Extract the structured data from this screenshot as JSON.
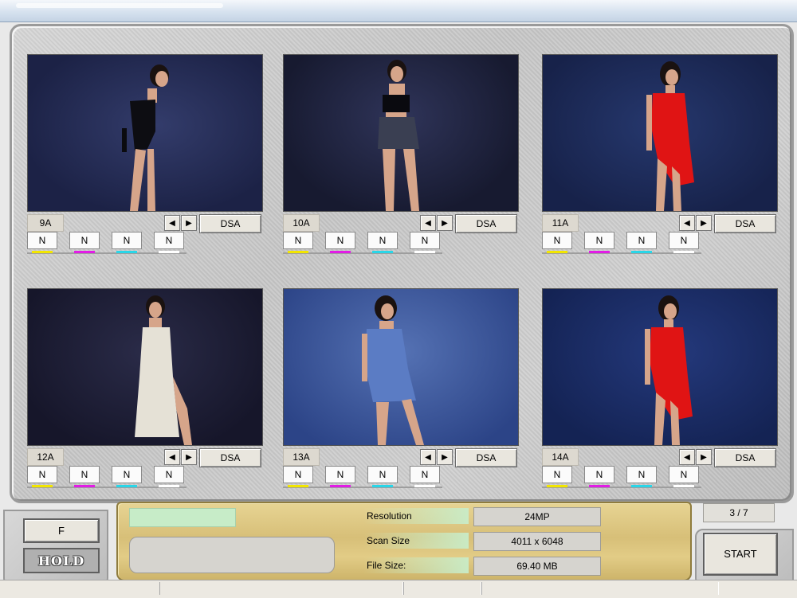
{
  "thumbnails": [
    {
      "label": "9A",
      "button": "DSA",
      "channels": [
        "N",
        "N",
        "N",
        "N"
      ]
    },
    {
      "label": "10A",
      "button": "DSA",
      "channels": [
        "N",
        "N",
        "N",
        "N"
      ]
    },
    {
      "label": "11A",
      "button": "DSA",
      "channels": [
        "N",
        "N",
        "N",
        "N"
      ]
    },
    {
      "label": "12A",
      "button": "DSA",
      "channels": [
        "N",
        "N",
        "N",
        "N"
      ]
    },
    {
      "label": "13A",
      "button": "DSA",
      "channels": [
        "N",
        "N",
        "N",
        "N"
      ]
    },
    {
      "label": "14A",
      "button": "DSA",
      "channels": [
        "N",
        "N",
        "N",
        "N"
      ]
    }
  ],
  "channel_colors": [
    "#f2e600",
    "#e21ce6",
    "#29d6e8",
    "#ffffff"
  ],
  "controls": {
    "f_label": "F",
    "hold_label": "HOLD",
    "start_label": "START",
    "page_counter": "3 / 7"
  },
  "info": {
    "resolution_label": "Resolution",
    "resolution_value": "24MP",
    "scan_size_label": "Scan Size",
    "scan_size_value": "4011 x 6048",
    "file_size_label": "File Size:",
    "file_size_value": "69.40 MB"
  },
  "icons": {
    "prev": "arrow-left-icon",
    "next": "arrow-right-icon"
  }
}
